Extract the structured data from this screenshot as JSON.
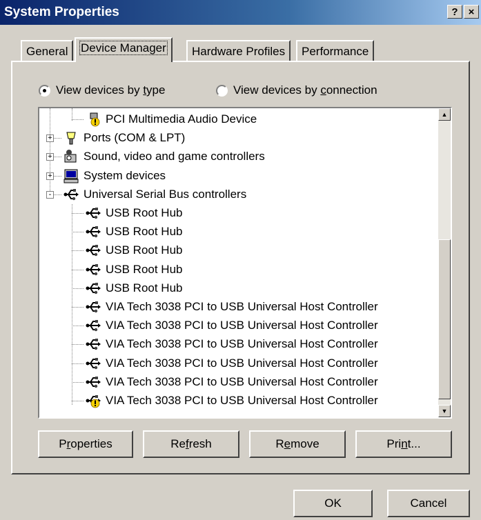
{
  "window": {
    "title": "System Properties",
    "help_label": "?",
    "close_label": "×"
  },
  "tabs": [
    {
      "label": "General"
    },
    {
      "label": "Device Manager"
    },
    {
      "label": "Hardware Profiles"
    },
    {
      "label": "Performance"
    }
  ],
  "view_options": [
    {
      "pre": "View devices by ",
      "key": "t",
      "post": "ype",
      "selected": true
    },
    {
      "pre": "View devices by ",
      "key": "c",
      "post": "onnection",
      "selected": false
    }
  ],
  "tree": [
    {
      "label": "PCI Multimedia Audio Device",
      "icon": "audio-warning-icon"
    },
    {
      "label": "Ports (COM & LPT)",
      "icon": "ports-icon"
    },
    {
      "label": "Sound, video and game controllers",
      "icon": "sound-controller-icon"
    },
    {
      "label": "System devices",
      "icon": "computer-icon"
    },
    {
      "label": "Universal Serial Bus controllers",
      "icon": "usb-icon"
    },
    {
      "label": "USB Root Hub",
      "icon": "usb-icon"
    },
    {
      "label": "USB Root Hub",
      "icon": "usb-icon"
    },
    {
      "label": "USB Root Hub",
      "icon": "usb-icon"
    },
    {
      "label": "USB Root Hub",
      "icon": "usb-icon"
    },
    {
      "label": "USB Root Hub",
      "icon": "usb-icon"
    },
    {
      "label": "VIA Tech 3038 PCI to USB Universal Host Controller",
      "icon": "usb-icon"
    },
    {
      "label": "VIA Tech 3038 PCI to USB Universal Host Controller",
      "icon": "usb-icon"
    },
    {
      "label": "VIA Tech 3038 PCI to USB Universal Host Controller",
      "icon": "usb-icon"
    },
    {
      "label": "VIA Tech 3038 PCI to USB Universal Host Controller",
      "icon": "usb-icon"
    },
    {
      "label": "VIA Tech 3038 PCI to USB Universal Host Controller",
      "icon": "usb-icon"
    },
    {
      "label": "VIA Tech 3038 PCI to USB Universal Host Controller",
      "icon": "usb-warning-icon"
    }
  ],
  "buttons": {
    "properties": {
      "pre": "P",
      "key": "r",
      "post": "operties"
    },
    "refresh": {
      "pre": "Re",
      "key": "f",
      "post": "resh"
    },
    "remove": {
      "pre": "R",
      "key": "e",
      "post": "move"
    },
    "print": {
      "pre": "Pri",
      "key": "n",
      "post": "t..."
    },
    "ok": "OK",
    "cancel": "Cancel"
  },
  "colors": {
    "face": "#d4d0c8",
    "title_start": "#0a246a",
    "title_end": "#a6caf0",
    "warning": "#f5d000"
  }
}
